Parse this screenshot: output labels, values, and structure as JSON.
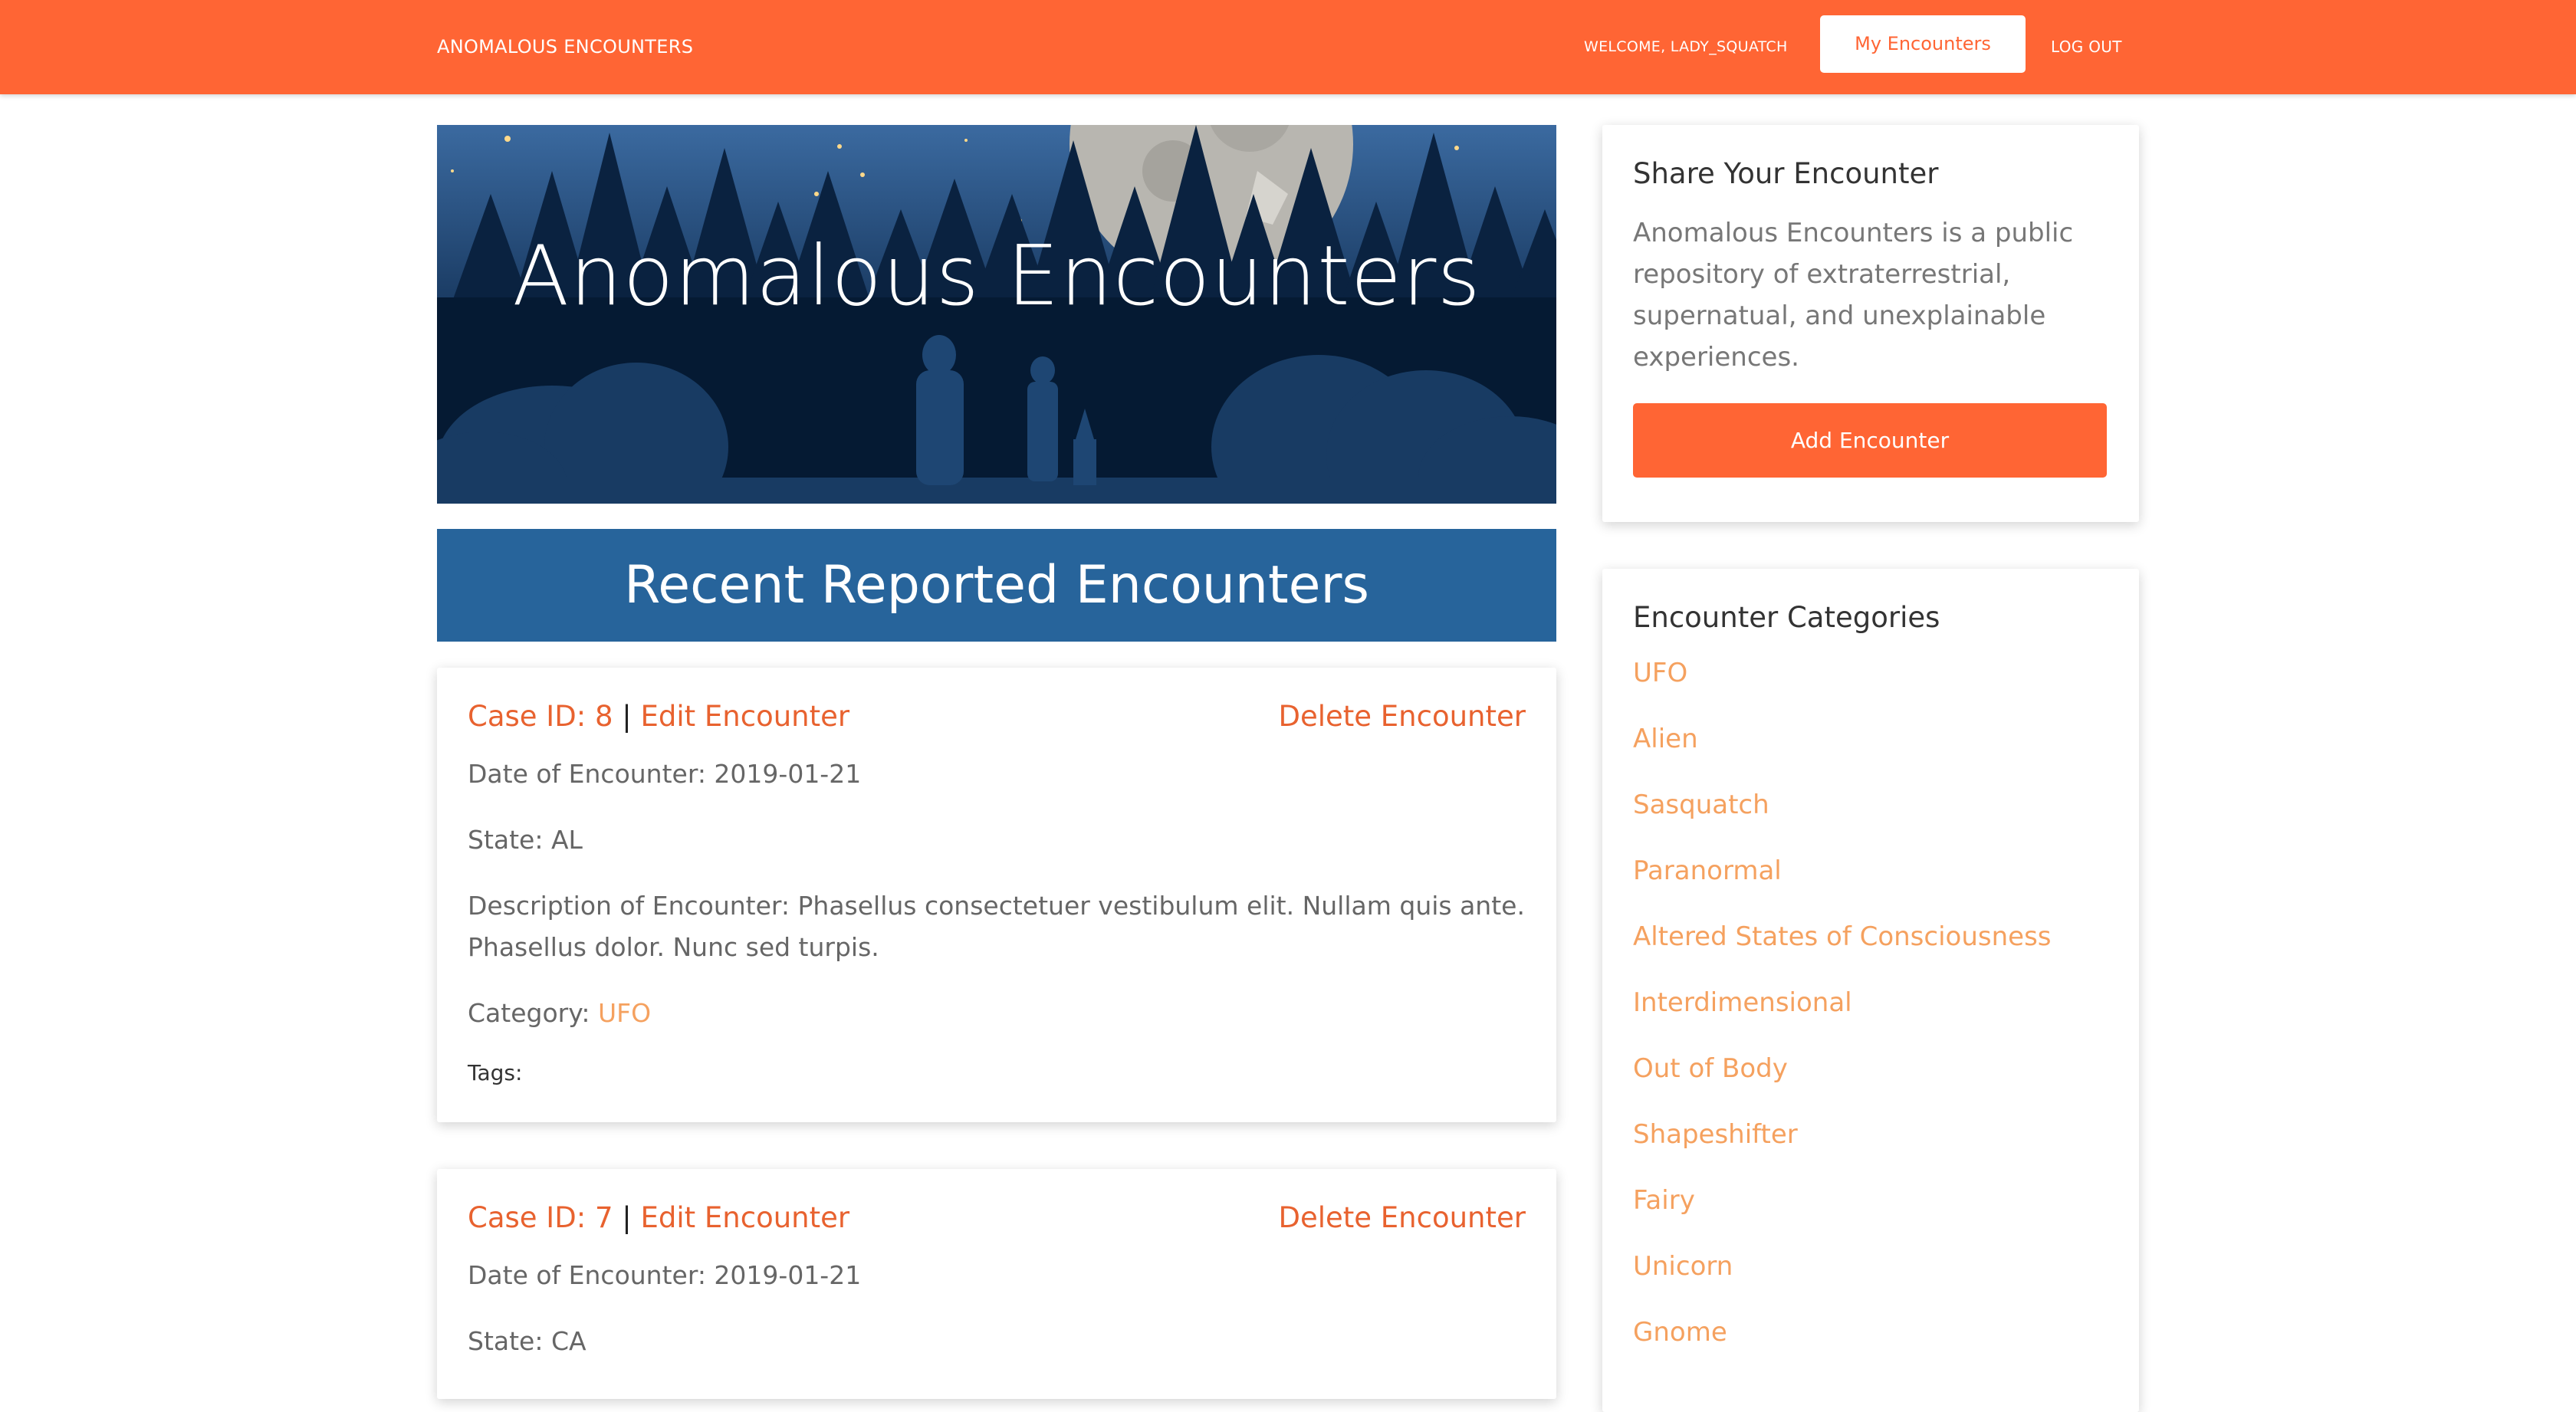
{
  "nav": {
    "brand": "ANOMALOUS ENCOUNTERS",
    "welcome": "WELCOME, LADY_SQUATCH",
    "my_encounters": "My Encounters",
    "logout": "LOG OUT"
  },
  "hero": {
    "title": "Anomalous Encounters"
  },
  "recent": {
    "heading": "Recent Reported Encounters"
  },
  "encounters": [
    {
      "case_id": "Case ID: 8",
      "separator": "|",
      "edit": "Edit Encounter",
      "delete": "Delete Encounter",
      "date": "Date of Encounter: 2019-01-21",
      "state": "State: AL",
      "description_1": "Description of Encounter: Phasellus consectetuer vestibulum elit. Nullam quis ante.",
      "description_2": "Phasellus dolor. Nunc sed turpis.",
      "category_label": "Category:",
      "category": "UFO",
      "tags": "Tags:"
    },
    {
      "case_id": "Case ID: 7",
      "separator": "|",
      "edit": "Edit Encounter",
      "delete": "Delete Encounter",
      "date": "Date of Encounter: 2019-01-21",
      "state": "State: CA"
    }
  ],
  "share": {
    "title": "Share Your Encounter",
    "text_1": "Anomalous Encounters is a public",
    "text_2": "repository of extraterrestrial,",
    "text_3": "supernatual, and unexplainable",
    "text_4": "experiences.",
    "button": "Add Encounter"
  },
  "categories": {
    "title": "Encounter Categories",
    "items": [
      "UFO",
      "Alien",
      "Sasquatch",
      "Paranormal",
      "Altered States of Consciousness",
      "Interdimensional",
      "Out of Body",
      "Shapeshifter",
      "Fairy",
      "Unicorn",
      "Gnome"
    ]
  },
  "colors": {
    "accent": "#FF6534",
    "link": "#E8622F",
    "category_link": "#F5A15F",
    "banner_blue": "#27649b",
    "hero_night": "#06203a"
  }
}
